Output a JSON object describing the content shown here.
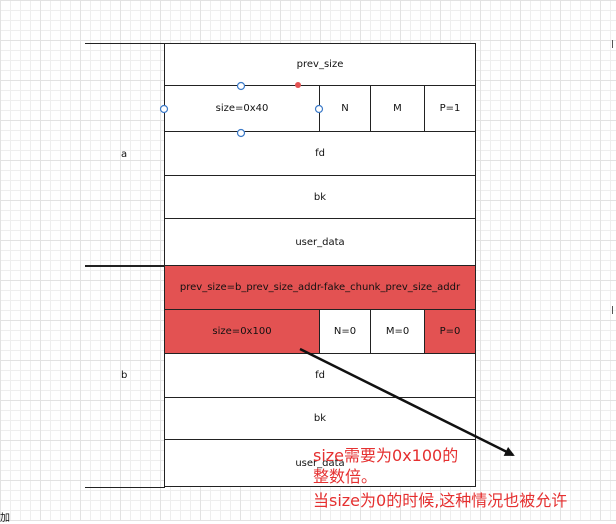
{
  "chunk_a": {
    "label": "a",
    "prev_size": "prev_size",
    "size": "size=0x40",
    "flag_n": "N",
    "flag_m": "M",
    "flag_p": "P=1",
    "fd": "fd",
    "bk": "bk",
    "user_data": "user_data"
  },
  "chunk_b": {
    "label": "b",
    "prev_size": "prev_size=b_prev_size_addr-fake_chunk_prev_size_addr",
    "size": "size=0x100",
    "flag_n": "N=0",
    "flag_m": "M=0",
    "flag_p": "P=0",
    "fd": "fd",
    "bk": "bk",
    "user_data": "user_data"
  },
  "annotation": {
    "line1": "size需要为0x100的",
    "line2": "整数倍。",
    "line3": "当size为0的时候,这种情况也被允许"
  },
  "edge_fragment": "加",
  "colors": {
    "highlight": "#e35252",
    "note_text": "#e53030",
    "selection_handle": "#3c7ac8",
    "anchor_point": "#e35252"
  }
}
